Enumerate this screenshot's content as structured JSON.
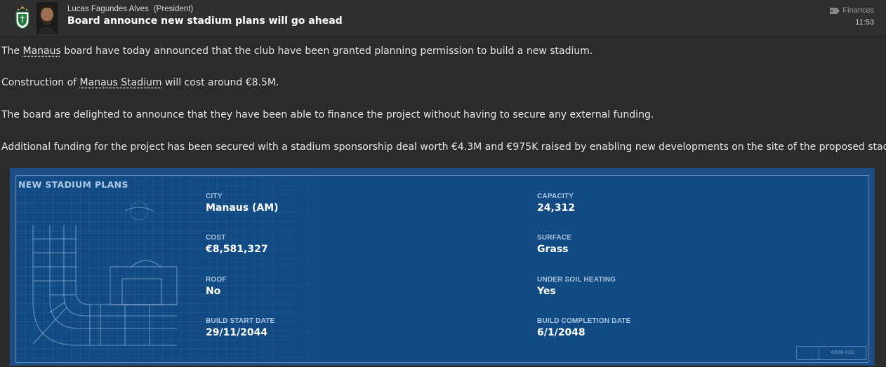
{
  "header": {
    "sender_name": "Lucas Fagundes Alves",
    "sender_role": "(President)",
    "subject": "Board announce new stadium plans will go ahead",
    "category": "Finances",
    "time": "11:53"
  },
  "body": {
    "p1_before": "The ",
    "p1_link": "Manaus",
    "p1_after": " board have today announced that the club have been granted planning permission to build a new stadium.",
    "p2_before": "Construction of ",
    "p2_link": "Manaus Stadium",
    "p2_after": " will cost around €8.5M.",
    "p3": "The board are delighted to announce that they have been able to finance the project without having to secure any external funding.",
    "p4": "Additional funding for the project has been secured with a stadium sponsorship deal worth €4.3M and €975K raised by enabling new developments on the site of the proposed stadium."
  },
  "panel": {
    "title": "NEW STADIUM PLANS",
    "stamp": "45588-0112",
    "fields": {
      "city": {
        "label": "CITY",
        "value": "Manaus (AM)"
      },
      "capacity": {
        "label": "CAPACITY",
        "value": "24,312"
      },
      "cost": {
        "label": "COST",
        "value": "€8,581,327"
      },
      "surface": {
        "label": "SURFACE",
        "value": "Grass"
      },
      "roof": {
        "label": "ROOF",
        "value": "No"
      },
      "heating": {
        "label": "UNDER SOIL HEATING",
        "value": "Yes"
      },
      "start": {
        "label": "BUILD START DATE",
        "value": "29/11/2044"
      },
      "completion": {
        "label": "BUILD COMPLETION DATE",
        "value": "6/1/2048"
      }
    }
  },
  "icons": {
    "crest": "club-crest-icon",
    "category": "tag-icon"
  },
  "colors": {
    "background": "#2b2b2b",
    "panel": "#124b84",
    "panel_label": "#a8c4e2"
  }
}
